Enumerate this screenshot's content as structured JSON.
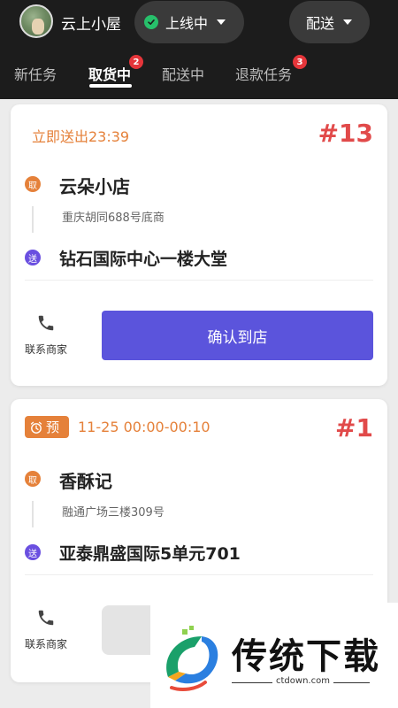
{
  "header": {
    "store_name": "云上小屋",
    "status": "上线中",
    "mode": "配送",
    "tabs": [
      {
        "label": "新任务"
      },
      {
        "label": "取货中",
        "badge": "2"
      },
      {
        "label": "配送中"
      },
      {
        "label": "退款任务",
        "badge": "3"
      }
    ]
  },
  "orders": [
    {
      "time": "立即送出23:39",
      "number": "#13",
      "pickup_icon": "取",
      "pickup_name": "云朵小店",
      "pickup_address": "重庆胡同688号底商",
      "dest_icon": "送",
      "dest_name": "钻石国际中心一楼大堂",
      "contact_label": "联系商家",
      "action_label": "确认到店"
    },
    {
      "pre_label": "预",
      "time": "11-25 00:00-00:10",
      "number": "#1",
      "pickup_icon": "取",
      "pickup_name": "香酥记",
      "pickup_address": "融通广场三楼309号",
      "dest_icon": "送",
      "dest_name": "亚泰鼎盛国际5单元701",
      "contact_label": "联系商家"
    }
  ],
  "watermark": {
    "brand": "传统下载",
    "url": "ctdown.com"
  },
  "colors": {
    "header_bg": "#1c1c1c",
    "accent": "#5b54dc",
    "order_red": "#e14a4a",
    "time_orange": "#e5813a",
    "online_green": "#27c06b"
  },
  "icons": {
    "status": "check-circle-icon",
    "caret": "caret-down-icon",
    "contact": "phone-icon",
    "pre": "alarm-clock-icon"
  }
}
